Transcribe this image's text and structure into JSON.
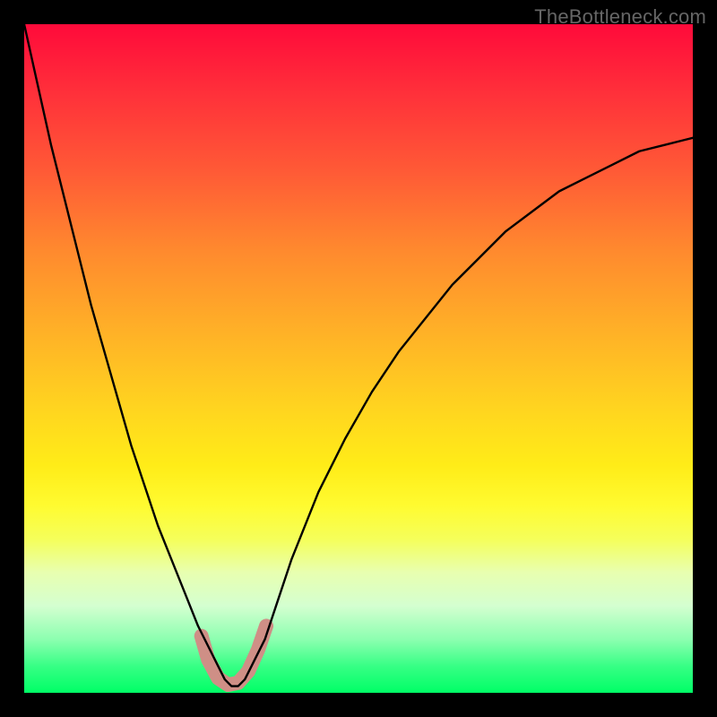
{
  "watermark": "TheBottleneck.com",
  "chart_data": {
    "type": "line",
    "title": "",
    "xlabel": "",
    "ylabel": "",
    "xlim": [
      0,
      100
    ],
    "ylim": [
      0,
      100
    ],
    "grid": false,
    "gradient_stops": [
      {
        "pos": 0,
        "color": "#ff0a3a"
      },
      {
        "pos": 10,
        "color": "#ff2f3a"
      },
      {
        "pos": 22,
        "color": "#ff5a36"
      },
      {
        "pos": 34,
        "color": "#ff8a2e"
      },
      {
        "pos": 46,
        "color": "#ffb127"
      },
      {
        "pos": 58,
        "color": "#ffd61f"
      },
      {
        "pos": 66,
        "color": "#ffec18"
      },
      {
        "pos": 72,
        "color": "#fffb30"
      },
      {
        "pos": 77,
        "color": "#f5ff5a"
      },
      {
        "pos": 82,
        "color": "#e8ffb0"
      },
      {
        "pos": 87,
        "color": "#d4ffd0"
      },
      {
        "pos": 92,
        "color": "#8cffb0"
      },
      {
        "pos": 96,
        "color": "#37ff85"
      },
      {
        "pos": 100,
        "color": "#00ff66"
      }
    ],
    "series": [
      {
        "name": "bottleneck-curve",
        "color": "#000000",
        "x": [
          0,
          2,
          4,
          6,
          8,
          10,
          12,
          14,
          16,
          18,
          20,
          22,
          24,
          26,
          28,
          29,
          30,
          31,
          32,
          33,
          34,
          36,
          38,
          40,
          44,
          48,
          52,
          56,
          60,
          64,
          68,
          72,
          76,
          80,
          84,
          88,
          92,
          96,
          100
        ],
        "y": [
          100,
          91,
          82,
          74,
          66,
          58,
          51,
          44,
          37,
          31,
          25,
          20,
          15,
          10,
          6,
          4,
          2,
          1,
          1,
          2,
          4,
          8,
          14,
          20,
          30,
          38,
          45,
          51,
          56,
          61,
          65,
          69,
          72,
          75,
          77,
          79,
          81,
          82,
          83
        ]
      }
    ],
    "highlight": {
      "color": "#cf8f86",
      "points": [
        {
          "x": 26.5,
          "y": 8.5
        },
        {
          "x": 27.5,
          "y": 5.0
        },
        {
          "x": 29.0,
          "y": 2.2
        },
        {
          "x": 30.5,
          "y": 1.2
        },
        {
          "x": 32.0,
          "y": 1.5
        },
        {
          "x": 33.5,
          "y": 3.2
        },
        {
          "x": 35.0,
          "y": 6.5
        },
        {
          "x": 36.2,
          "y": 10.0
        }
      ]
    }
  }
}
